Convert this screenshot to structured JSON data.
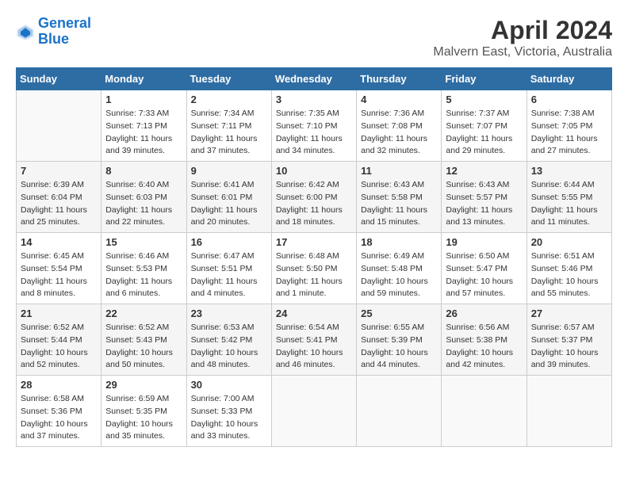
{
  "logo": {
    "line1": "General",
    "line2": "Blue"
  },
  "title": "April 2024",
  "subtitle": "Malvern East, Victoria, Australia",
  "weekdays": [
    "Sunday",
    "Monday",
    "Tuesday",
    "Wednesday",
    "Thursday",
    "Friday",
    "Saturday"
  ],
  "weeks": [
    [
      {
        "num": "",
        "info": ""
      },
      {
        "num": "1",
        "info": "Sunrise: 7:33 AM\nSunset: 7:13 PM\nDaylight: 11 hours\nand 39 minutes."
      },
      {
        "num": "2",
        "info": "Sunrise: 7:34 AM\nSunset: 7:11 PM\nDaylight: 11 hours\nand 37 minutes."
      },
      {
        "num": "3",
        "info": "Sunrise: 7:35 AM\nSunset: 7:10 PM\nDaylight: 11 hours\nand 34 minutes."
      },
      {
        "num": "4",
        "info": "Sunrise: 7:36 AM\nSunset: 7:08 PM\nDaylight: 11 hours\nand 32 minutes."
      },
      {
        "num": "5",
        "info": "Sunrise: 7:37 AM\nSunset: 7:07 PM\nDaylight: 11 hours\nand 29 minutes."
      },
      {
        "num": "6",
        "info": "Sunrise: 7:38 AM\nSunset: 7:05 PM\nDaylight: 11 hours\nand 27 minutes."
      }
    ],
    [
      {
        "num": "7",
        "info": "Sunrise: 6:39 AM\nSunset: 6:04 PM\nDaylight: 11 hours\nand 25 minutes."
      },
      {
        "num": "8",
        "info": "Sunrise: 6:40 AM\nSunset: 6:03 PM\nDaylight: 11 hours\nand 22 minutes."
      },
      {
        "num": "9",
        "info": "Sunrise: 6:41 AM\nSunset: 6:01 PM\nDaylight: 11 hours\nand 20 minutes."
      },
      {
        "num": "10",
        "info": "Sunrise: 6:42 AM\nSunset: 6:00 PM\nDaylight: 11 hours\nand 18 minutes."
      },
      {
        "num": "11",
        "info": "Sunrise: 6:43 AM\nSunset: 5:58 PM\nDaylight: 11 hours\nand 15 minutes."
      },
      {
        "num": "12",
        "info": "Sunrise: 6:43 AM\nSunset: 5:57 PM\nDaylight: 11 hours\nand 13 minutes."
      },
      {
        "num": "13",
        "info": "Sunrise: 6:44 AM\nSunset: 5:55 PM\nDaylight: 11 hours\nand 11 minutes."
      }
    ],
    [
      {
        "num": "14",
        "info": "Sunrise: 6:45 AM\nSunset: 5:54 PM\nDaylight: 11 hours\nand 8 minutes."
      },
      {
        "num": "15",
        "info": "Sunrise: 6:46 AM\nSunset: 5:53 PM\nDaylight: 11 hours\nand 6 minutes."
      },
      {
        "num": "16",
        "info": "Sunrise: 6:47 AM\nSunset: 5:51 PM\nDaylight: 11 hours\nand 4 minutes."
      },
      {
        "num": "17",
        "info": "Sunrise: 6:48 AM\nSunset: 5:50 PM\nDaylight: 11 hours\nand 1 minute."
      },
      {
        "num": "18",
        "info": "Sunrise: 6:49 AM\nSunset: 5:48 PM\nDaylight: 10 hours\nand 59 minutes."
      },
      {
        "num": "19",
        "info": "Sunrise: 6:50 AM\nSunset: 5:47 PM\nDaylight: 10 hours\nand 57 minutes."
      },
      {
        "num": "20",
        "info": "Sunrise: 6:51 AM\nSunset: 5:46 PM\nDaylight: 10 hours\nand 55 minutes."
      }
    ],
    [
      {
        "num": "21",
        "info": "Sunrise: 6:52 AM\nSunset: 5:44 PM\nDaylight: 10 hours\nand 52 minutes."
      },
      {
        "num": "22",
        "info": "Sunrise: 6:52 AM\nSunset: 5:43 PM\nDaylight: 10 hours\nand 50 minutes."
      },
      {
        "num": "23",
        "info": "Sunrise: 6:53 AM\nSunset: 5:42 PM\nDaylight: 10 hours\nand 48 minutes."
      },
      {
        "num": "24",
        "info": "Sunrise: 6:54 AM\nSunset: 5:41 PM\nDaylight: 10 hours\nand 46 minutes."
      },
      {
        "num": "25",
        "info": "Sunrise: 6:55 AM\nSunset: 5:39 PM\nDaylight: 10 hours\nand 44 minutes."
      },
      {
        "num": "26",
        "info": "Sunrise: 6:56 AM\nSunset: 5:38 PM\nDaylight: 10 hours\nand 42 minutes."
      },
      {
        "num": "27",
        "info": "Sunrise: 6:57 AM\nSunset: 5:37 PM\nDaylight: 10 hours\nand 39 minutes."
      }
    ],
    [
      {
        "num": "28",
        "info": "Sunrise: 6:58 AM\nSunset: 5:36 PM\nDaylight: 10 hours\nand 37 minutes."
      },
      {
        "num": "29",
        "info": "Sunrise: 6:59 AM\nSunset: 5:35 PM\nDaylight: 10 hours\nand 35 minutes."
      },
      {
        "num": "30",
        "info": "Sunrise: 7:00 AM\nSunset: 5:33 PM\nDaylight: 10 hours\nand 33 minutes."
      },
      {
        "num": "",
        "info": ""
      },
      {
        "num": "",
        "info": ""
      },
      {
        "num": "",
        "info": ""
      },
      {
        "num": "",
        "info": ""
      }
    ]
  ]
}
